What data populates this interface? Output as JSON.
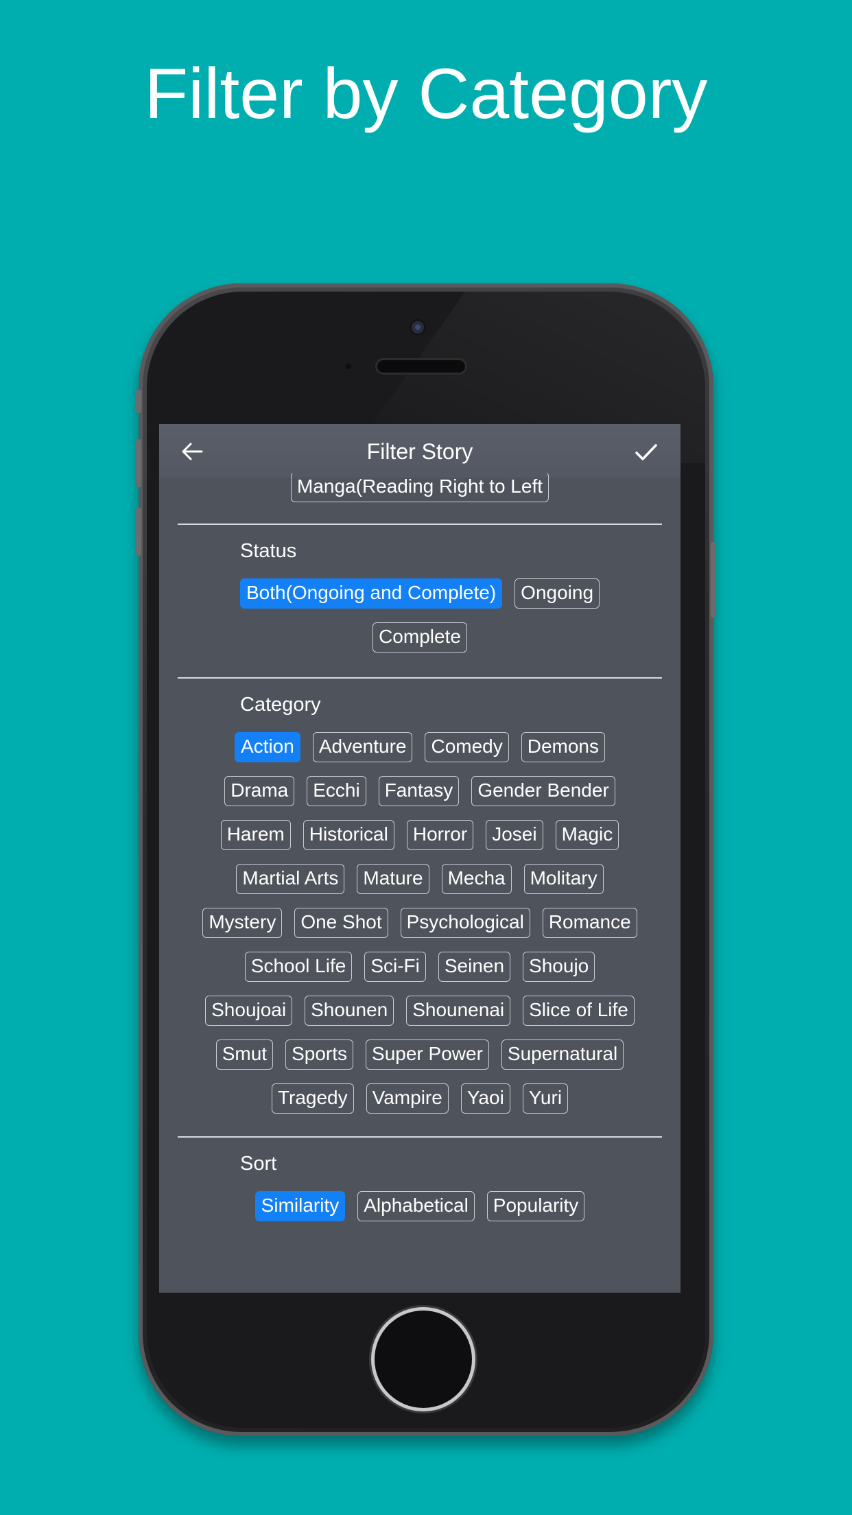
{
  "promo": {
    "title": "Filter by Category"
  },
  "nav": {
    "title": "Filter Story",
    "back_icon": "arrow-left-icon",
    "done_icon": "checkmark-icon"
  },
  "reading_direction": {
    "option": "Manga(Reading Right to Left"
  },
  "status": {
    "label": "Status",
    "options": [
      "Both(Ongoing and Complete)",
      "Ongoing",
      "Complete"
    ],
    "selected": "Both(Ongoing and Complete)"
  },
  "category": {
    "label": "Category",
    "options": [
      "Action",
      "Adventure",
      "Comedy",
      "Demons",
      "Drama",
      "Ecchi",
      "Fantasy",
      "Gender Bender",
      "Harem",
      "Historical",
      "Horror",
      "Josei",
      "Magic",
      "Martial Arts",
      "Mature",
      "Mecha",
      "Molitary",
      "Mystery",
      "One Shot",
      "Psychological",
      "Romance",
      "School Life",
      "Sci-Fi",
      "Seinen",
      "Shoujo",
      "Shoujoai",
      "Shounen",
      "Shounenai",
      "Slice of Life",
      "Smut",
      "Sports",
      "Super Power",
      "Supernatural",
      "Tragedy",
      "Vampire",
      "Yaoi",
      "Yuri"
    ],
    "selected": "Action"
  },
  "sort": {
    "label": "Sort",
    "options": [
      "Similarity",
      "Alphabetical",
      "Popularity"
    ],
    "selected": "Similarity"
  },
  "colors": {
    "background": "#00aeaf",
    "screen": "#4f535c",
    "accent": "#1380f5",
    "chip_border": "#c9ccd2"
  }
}
